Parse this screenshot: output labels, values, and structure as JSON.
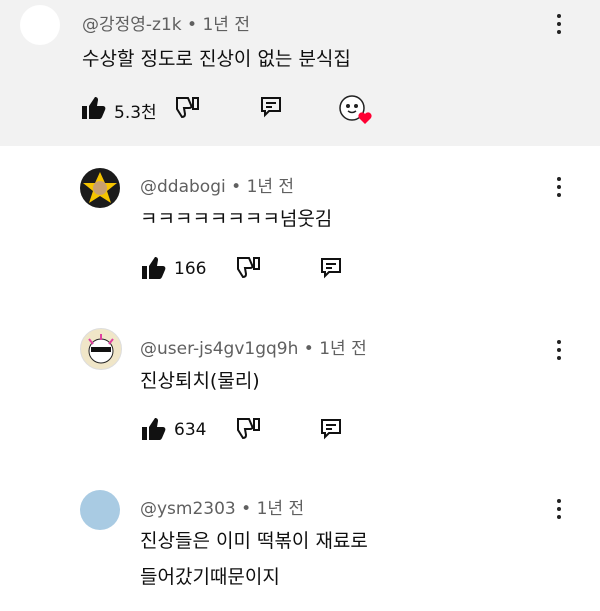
{
  "comments": [
    {
      "handle": "@강정영-z1k",
      "time": "1년 전",
      "text": "수상할 정도로 진상이 없는 분식집",
      "likes": "5.3천",
      "avatar_color": "#ffffff",
      "highlighted": true,
      "icons": [
        "thumbs-up-icon",
        "thumbs-down-icon",
        "reply-icon",
        "creator-heart-icon"
      ]
    },
    {
      "handle": "@ddabogi",
      "time": "1년 전",
      "text": "ㅋㅋㅋㅋㅋㅋㅋㅋ넘웃김",
      "likes": "166",
      "avatar_color": "#f5c400"
    },
    {
      "handle": "@user-js4gv1gq9h",
      "time": "1년 전",
      "text": "진상퇴치(물리)",
      "likes": "634",
      "avatar_color": "#f0e6c8"
    },
    {
      "handle": "@ysm2303",
      "time": "1년 전",
      "text_line1": "진상들은 이미 떡볶이 재료로",
      "text_line2": "들어갔기때문이지",
      "avatar_color": "#a9cbe3"
    }
  ],
  "separator": "•"
}
